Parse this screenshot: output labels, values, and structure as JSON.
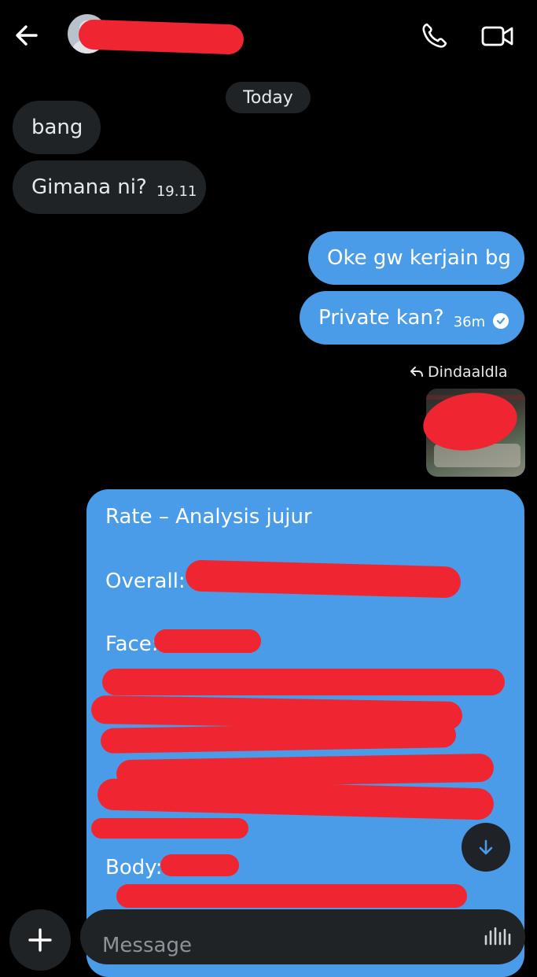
{
  "header": {
    "back_icon": "arrow-left-icon",
    "avatar_icon": "default-user-avatar",
    "call_icon": "phone-icon",
    "video_icon": "video-camera-icon"
  },
  "date_divider": "Today",
  "messages": [
    {
      "side": "incoming",
      "text": "bang",
      "time": ""
    },
    {
      "side": "incoming",
      "text": "Gimana ni?",
      "time": "19.11"
    },
    {
      "side": "outgoing",
      "text": "Oke gw kerjain bg",
      "time": ""
    },
    {
      "side": "outgoing",
      "text": "Private kan?",
      "time": "36m",
      "status_icon": "read-check-icon"
    }
  ],
  "reply": {
    "icon": "reply-arrow-icon",
    "author": "Dindaaldla"
  },
  "card": {
    "title": "Rate – Analysis jujur",
    "overall_label": "Overall:",
    "face_label": "Face:",
    "body_label": "Body:"
  },
  "scroll_button_icon": "arrow-down-icon",
  "composer": {
    "add_icon": "plus-icon",
    "placeholder": "Message",
    "voice_icon": "audio-waveform-icon"
  },
  "colors": {
    "background": "#000000",
    "incoming_bubble": "#202326",
    "outgoing_bubble": "#4b9ce8",
    "redaction": "#ef2632"
  }
}
